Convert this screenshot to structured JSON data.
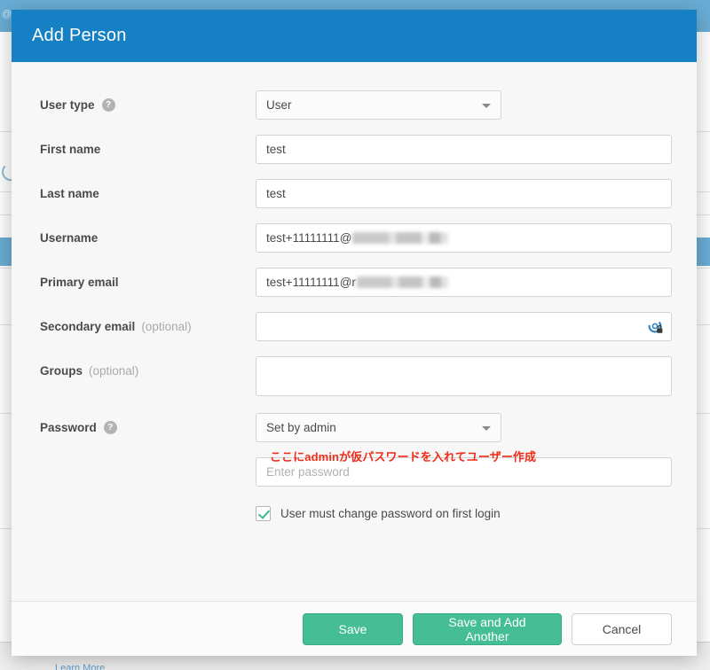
{
  "backdrop": {
    "topbar_text": "@a",
    "footer_link": "Learn More"
  },
  "modal": {
    "title": "Add Person",
    "fields": {
      "user_type": {
        "label": "User type",
        "help_icon": "question-mark-icon",
        "value": "User",
        "caret_icon": "chevron-down-icon"
      },
      "first_name": {
        "label": "First name",
        "value": "test",
        "placeholder": ""
      },
      "last_name": {
        "label": "Last name",
        "value": "test",
        "placeholder": ""
      },
      "username": {
        "label": "Username",
        "value": "test+11111111@",
        "redacted": true,
        "placeholder": ""
      },
      "primary_email": {
        "label": "Primary email",
        "value": "test+11111111@r",
        "redacted": true,
        "placeholder": ""
      },
      "secondary_email": {
        "label": "Secondary email",
        "optional": "(optional)",
        "value": "",
        "placeholder": "",
        "icon": "password-manager-lock-icon"
      },
      "groups": {
        "label": "Groups",
        "optional": "(optional)",
        "value": ""
      },
      "password": {
        "label": "Password",
        "help_icon": "question-mark-icon",
        "mode_value": "Set by admin",
        "caret_icon": "chevron-down-icon",
        "placeholder": "Enter password",
        "value": "",
        "annotation": "ここにadminが仮パスワードを入れてユーザー作成",
        "annotation_color": "#ef2d1a"
      },
      "must_change": {
        "label": "User must change password on first login",
        "checked": true
      }
    },
    "footer": {
      "save_label": "Save",
      "save_add_another_label": "Save and Add Another",
      "cancel_label": "Cancel"
    }
  },
  "colors": {
    "header_blue": "#1580c4",
    "primary_green": "#45bd95",
    "annotation_red": "#ef2d1a",
    "body_bg": "#f7f7f7"
  }
}
